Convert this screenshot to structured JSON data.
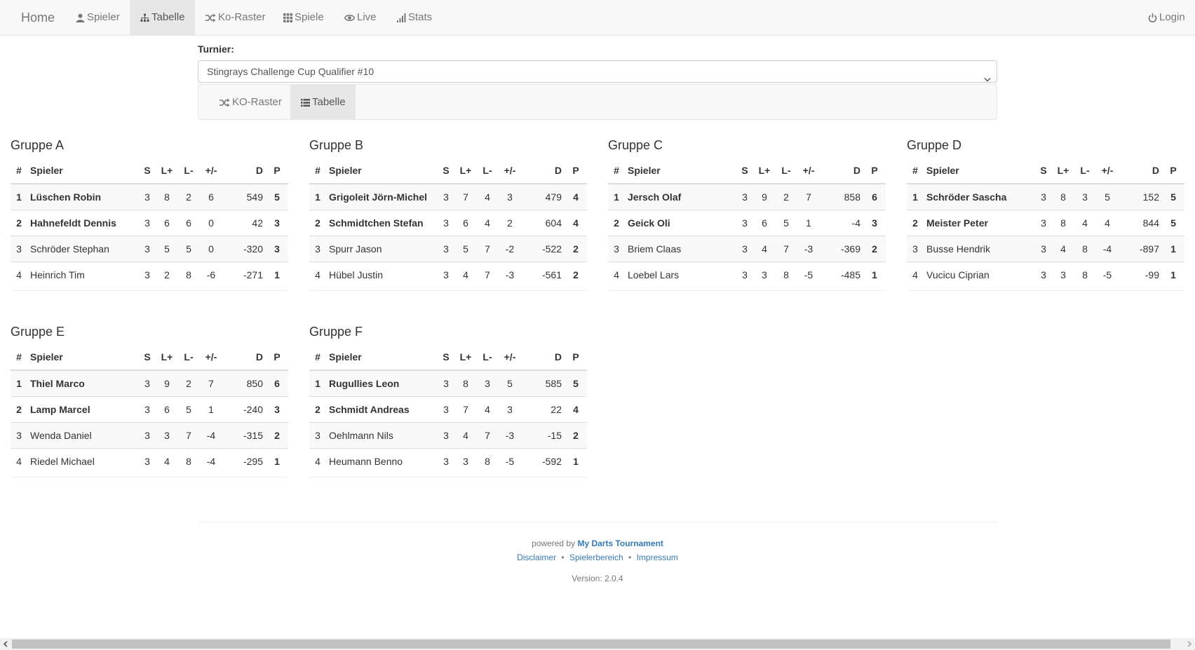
{
  "nav": {
    "brand": "Home",
    "items": [
      {
        "label": "Spieler",
        "icon": "user-icon"
      },
      {
        "label": "Tabelle",
        "icon": "sitemap-icon",
        "active": true
      },
      {
        "label": "Ko-Raster",
        "icon": "random-icon"
      },
      {
        "label": "Spiele",
        "icon": "grid-icon"
      },
      {
        "label": "Live",
        "icon": "eye-icon"
      },
      {
        "label": "Stats",
        "icon": "signal-icon"
      }
    ],
    "login": {
      "label": "Login",
      "icon": "power-icon"
    }
  },
  "turnier": {
    "label": "Turnier:",
    "selected": "Stingrays Challenge Cup Qualifier #10"
  },
  "subnav": [
    {
      "label": "KO-Raster",
      "icon": "random-icon"
    },
    {
      "label": "Tabelle",
      "icon": "list-icon",
      "active": true
    }
  ],
  "table_headers": {
    "rank": "#",
    "player": "Spieler",
    "s": "S",
    "lplus": "L+",
    "lminus": "L-",
    "diff": "+/-",
    "d": "D",
    "p": "P"
  },
  "groups": [
    {
      "title": "Gruppe A",
      "rows": [
        {
          "rank": "1",
          "name": "Lüschen Robin",
          "s": "3",
          "lplus": "8",
          "lminus": "2",
          "diff": "6",
          "d": "549",
          "p": "5"
        },
        {
          "rank": "2",
          "name": "Hahnefeldt Dennis",
          "s": "3",
          "lplus": "6",
          "lminus": "6",
          "diff": "0",
          "d": "42",
          "p": "3"
        },
        {
          "rank": "3",
          "name": "Schröder Stephan",
          "s": "3",
          "lplus": "5",
          "lminus": "5",
          "diff": "0",
          "d": "-320",
          "p": "3"
        },
        {
          "rank": "4",
          "name": "Heinrich Tim",
          "s": "3",
          "lplus": "2",
          "lminus": "8",
          "diff": "-6",
          "d": "-271",
          "p": "1"
        }
      ]
    },
    {
      "title": "Gruppe B",
      "rows": [
        {
          "rank": "1",
          "name": "Grigoleit Jörn-Michel",
          "s": "3",
          "lplus": "7",
          "lminus": "4",
          "diff": "3",
          "d": "479",
          "p": "4"
        },
        {
          "rank": "2",
          "name": "Schmidtchen Stefan",
          "s": "3",
          "lplus": "6",
          "lminus": "4",
          "diff": "2",
          "d": "604",
          "p": "4"
        },
        {
          "rank": "3",
          "name": "Spurr Jason",
          "s": "3",
          "lplus": "5",
          "lminus": "7",
          "diff": "-2",
          "d": "-522",
          "p": "2"
        },
        {
          "rank": "4",
          "name": "Hübel Justin",
          "s": "3",
          "lplus": "4",
          "lminus": "7",
          "diff": "-3",
          "d": "-561",
          "p": "2"
        }
      ]
    },
    {
      "title": "Gruppe C",
      "rows": [
        {
          "rank": "1",
          "name": "Jersch Olaf",
          "s": "3",
          "lplus": "9",
          "lminus": "2",
          "diff": "7",
          "d": "858",
          "p": "6"
        },
        {
          "rank": "2",
          "name": "Geick Oli",
          "s": "3",
          "lplus": "6",
          "lminus": "5",
          "diff": "1",
          "d": "-4",
          "p": "3"
        },
        {
          "rank": "3",
          "name": "Briem Claas",
          "s": "3",
          "lplus": "4",
          "lminus": "7",
          "diff": "-3",
          "d": "-369",
          "p": "2"
        },
        {
          "rank": "4",
          "name": "Loebel Lars",
          "s": "3",
          "lplus": "3",
          "lminus": "8",
          "diff": "-5",
          "d": "-485",
          "p": "1"
        }
      ]
    },
    {
      "title": "Gruppe D",
      "rows": [
        {
          "rank": "1",
          "name": "Schröder Sascha",
          "s": "3",
          "lplus": "8",
          "lminus": "3",
          "diff": "5",
          "d": "152",
          "p": "5"
        },
        {
          "rank": "2",
          "name": "Meister Peter",
          "s": "3",
          "lplus": "8",
          "lminus": "4",
          "diff": "4",
          "d": "844",
          "p": "5"
        },
        {
          "rank": "3",
          "name": "Busse Hendrik",
          "s": "3",
          "lplus": "4",
          "lminus": "8",
          "diff": "-4",
          "d": "-897",
          "p": "1"
        },
        {
          "rank": "4",
          "name": "Vucicu Ciprian",
          "s": "3",
          "lplus": "3",
          "lminus": "8",
          "diff": "-5",
          "d": "-99",
          "p": "1"
        }
      ]
    },
    {
      "title": "Gruppe E",
      "rows": [
        {
          "rank": "1",
          "name": "Thiel Marco",
          "s": "3",
          "lplus": "9",
          "lminus": "2",
          "diff": "7",
          "d": "850",
          "p": "6"
        },
        {
          "rank": "2",
          "name": "Lamp Marcel",
          "s": "3",
          "lplus": "6",
          "lminus": "5",
          "diff": "1",
          "d": "-240",
          "p": "3"
        },
        {
          "rank": "3",
          "name": "Wenda Daniel",
          "s": "3",
          "lplus": "3",
          "lminus": "7",
          "diff": "-4",
          "d": "-315",
          "p": "2"
        },
        {
          "rank": "4",
          "name": "Riedel Michael",
          "s": "3",
          "lplus": "4",
          "lminus": "8",
          "diff": "-4",
          "d": "-295",
          "p": "1"
        }
      ]
    },
    {
      "title": "Gruppe F",
      "rows": [
        {
          "rank": "1",
          "name": "Rugullies Leon",
          "s": "3",
          "lplus": "8",
          "lminus": "3",
          "diff": "5",
          "d": "585",
          "p": "5"
        },
        {
          "rank": "2",
          "name": "Schmidt Andreas",
          "s": "3",
          "lplus": "7",
          "lminus": "4",
          "diff": "3",
          "d": "22",
          "p": "4"
        },
        {
          "rank": "3",
          "name": "Oehlmann Nils",
          "s": "3",
          "lplus": "4",
          "lminus": "7",
          "diff": "-3",
          "d": "-15",
          "p": "2"
        },
        {
          "rank": "4",
          "name": "Heumann Benno",
          "s": "3",
          "lplus": "3",
          "lminus": "8",
          "diff": "-5",
          "d": "-592",
          "p": "1"
        }
      ]
    }
  ],
  "footer": {
    "powered_by": "powered by",
    "brand": "My Darts Tournament",
    "links": [
      "Disclaimer",
      "Spielerbereich",
      "Impressum"
    ],
    "separator": "•",
    "version": "Version: 2.0.4"
  },
  "colors": {
    "link": "#337ab7",
    "nav_bg": "#f8f8f8",
    "nav_active": "#e7e7e7"
  }
}
